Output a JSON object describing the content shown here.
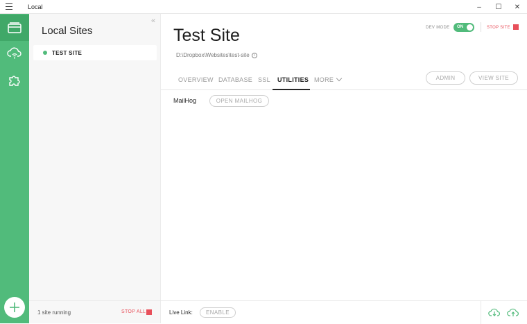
{
  "window": {
    "title": "Local",
    "min": "–",
    "max": "☐",
    "close": "✕"
  },
  "rail": {
    "items": [
      "sites-icon",
      "cloud-connect-icon",
      "addons-icon"
    ],
    "add_label": "+"
  },
  "sites_panel": {
    "heading": "Local Sites",
    "collapse": "«",
    "sites": [
      {
        "name": "TEST SITE",
        "status": "running"
      }
    ],
    "footer": {
      "running_text": "1 site running",
      "stop_all": "STOP ALL"
    }
  },
  "site": {
    "title": "Test Site",
    "path": "D:\\Dropbox\\Websites\\test-site",
    "path_icon": "i",
    "dev_mode_label": "DEV MODE",
    "dev_mode_value": "ON",
    "stop_site": "STOP SITE",
    "tabs": [
      "OVERVIEW",
      "DATABASE",
      "SSL",
      "UTILITIES",
      "MORE"
    ],
    "active_tab": "UTILITIES",
    "admin": "ADMIN",
    "view_site": "VIEW SITE",
    "mailhog_label": "MailHog",
    "open_mailhog": "OPEN MAILHOG",
    "live_link_label": "Live Link:",
    "enable": "ENABLE"
  },
  "colors": {
    "accent": "#51bb7b",
    "stop": "#e8505b"
  }
}
